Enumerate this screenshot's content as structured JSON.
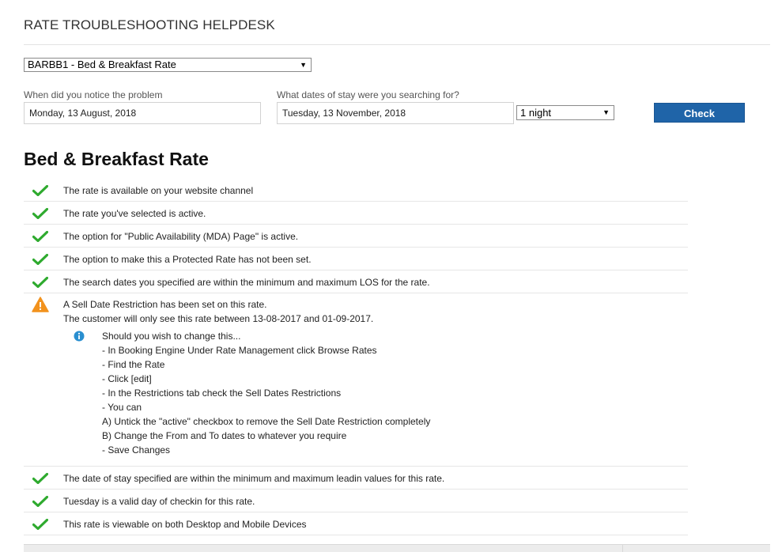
{
  "header": {
    "title": "RATE TROUBLESHOOTING HELPDESK"
  },
  "rate_select": {
    "value": "BARBB1 - Bed & Breakfast Rate"
  },
  "notice_field": {
    "label": "When did you notice the problem",
    "value": "Monday, 13 August, 2018"
  },
  "stay_field": {
    "label": "What dates of stay were you searching for?",
    "value": "Tuesday, 13 November, 2018"
  },
  "nights_select": {
    "value": "1 night"
  },
  "check_button": {
    "label": "Check"
  },
  "section": {
    "heading": "Bed & Breakfast Rate"
  },
  "checks_top": [
    {
      "status": "ok",
      "text": "The rate is available on your website channel"
    },
    {
      "status": "ok",
      "text": "The rate you've selected is active."
    },
    {
      "status": "ok",
      "text": "The option for \"Public Availability (MDA) Page\" is active."
    },
    {
      "status": "ok",
      "text": "The option to make this a Protected Rate has not been set."
    },
    {
      "status": "ok",
      "text": "The search dates you specified are within the minimum and maximum LOS for the rate."
    }
  ],
  "warning": {
    "status": "warning",
    "line1": "A Sell Date Restriction has been set on this rate.",
    "line2": "The customer will only see this rate between 13-08-2017 and 01-09-2017.",
    "info_lines": [
      "Should you wish to change this...",
      "- In Booking Engine Under Rate Management click Browse Rates",
      "- Find the Rate",
      "- Click [edit]",
      "- In the Restrictions tab check the Sell Dates Restrictions",
      "- You can",
      "A) Untick the \"active\" checkbox to remove the Sell Date Restriction completely",
      "B) Change the From and To dates to whatever you require",
      "- Save Changes"
    ]
  },
  "checks_bottom": [
    {
      "status": "ok",
      "text": "The date of stay specified are within the minimum and maximum leadin values for this rate."
    },
    {
      "status": "ok",
      "text": "Tuesday is a valid day of checkin for this rate."
    },
    {
      "status": "ok",
      "text": "This rate is viewable on both Desktop and Mobile Devices"
    }
  ],
  "colors": {
    "ok": "#2eaa2e",
    "warning": "#f2921d",
    "info": "#2a8fd0",
    "button": "#1f64a8"
  }
}
